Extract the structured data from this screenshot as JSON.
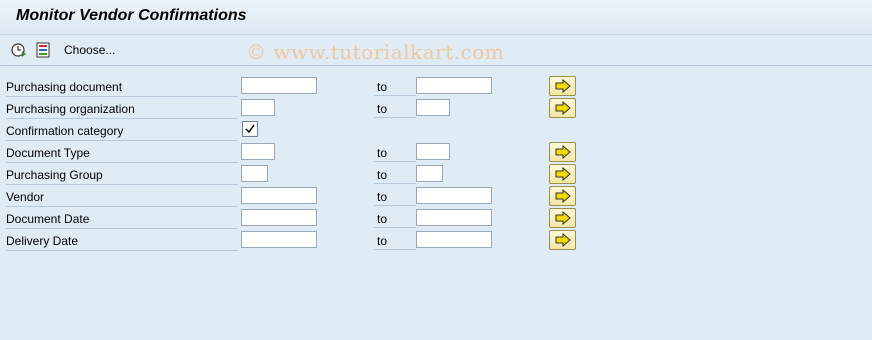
{
  "title": "Monitor Vendor Confirmations",
  "toolbar": {
    "execute_icon": "execute-clock-icon",
    "variant_icon": "get-variant-icon",
    "choose_label": "Choose..."
  },
  "watermark": "© www.tutorialkart.com",
  "rows": [
    {
      "label": "Purchasing document",
      "to": "to",
      "low": "",
      "high": ""
    },
    {
      "label": "Purchasing organization",
      "to": "to",
      "low": "",
      "high": ""
    },
    {
      "label": "Confirmation category",
      "checked": true
    },
    {
      "label": "Document Type",
      "to": "to",
      "low": "",
      "high": ""
    },
    {
      "label": "Purchasing Group",
      "to": "to",
      "low": "",
      "high": ""
    },
    {
      "label": "Vendor",
      "to": "to",
      "low": "",
      "high": ""
    },
    {
      "label": "Document Date",
      "to": "to",
      "low": "",
      "high": ""
    },
    {
      "label": "Delivery Date",
      "to": "to",
      "low": "",
      "high": ""
    }
  ],
  "colors": {
    "background": "#dfebf5",
    "multiselect_button": "#f3e6a6"
  }
}
